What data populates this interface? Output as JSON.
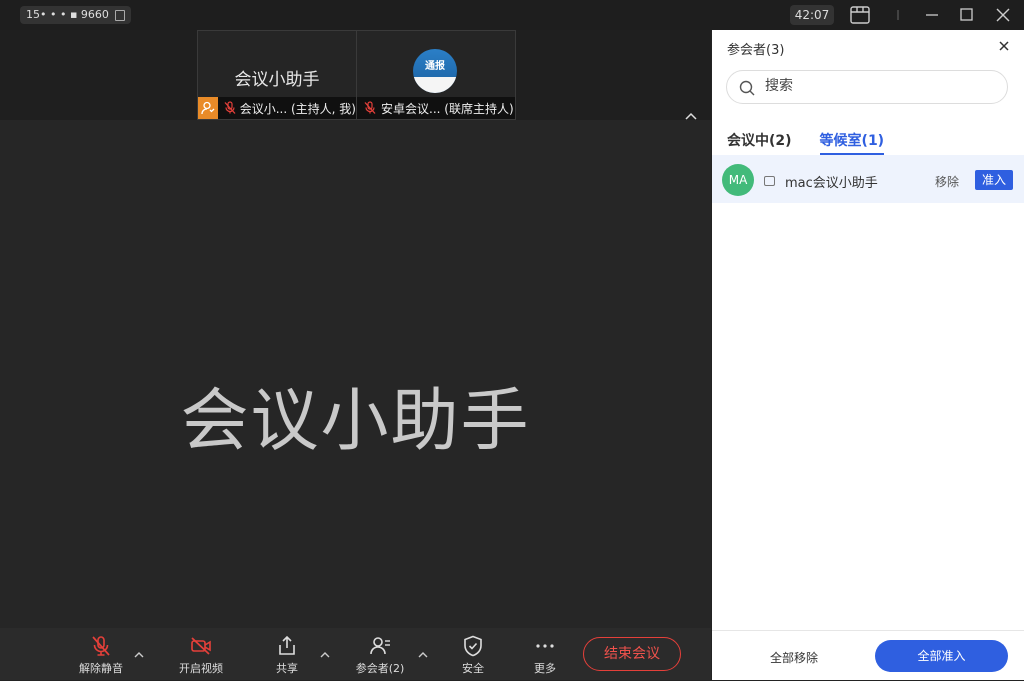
{
  "titlebar": {
    "meeting_id": "15• • • ▪ 9660",
    "timer": "42:07",
    "icons": [
      "copy-icon",
      "layout-icon",
      "minimize-icon",
      "maximize-icon",
      "close-icon"
    ]
  },
  "thumbnails": [
    {
      "display_name": "会议小助手",
      "label": "会议小...  (主持人, 我)"
    },
    {
      "avatar_text": "通报",
      "label": "安卓会议...  (联席主持人)"
    }
  ],
  "main": {
    "speaker_name": "会议小助手"
  },
  "toolbar": {
    "unmute_label": "解除静音",
    "video_label": "开启视频",
    "share_label": "共享",
    "participants_label": "参会者(2)",
    "security_label": "安全",
    "more_label": "更多",
    "end_label": "结束会议",
    "colors": {
      "danger": "#e5403a"
    }
  },
  "panel": {
    "title": "参会者(3)",
    "search_placeholder": "搜索",
    "tabs": [
      {
        "label": "会议中(2)",
        "active": false
      },
      {
        "label": "等候室(1)",
        "active": true
      }
    ],
    "waiting": [
      {
        "initials": "MA",
        "name": "mac会议小助手",
        "remove_label": "移除",
        "admit_label": "准入"
      }
    ],
    "remove_all_label": "全部移除",
    "admit_all_label": "全部准入",
    "colors": {
      "accent": "#2f5fe0",
      "avatar_bg": "#42ba7a"
    }
  }
}
